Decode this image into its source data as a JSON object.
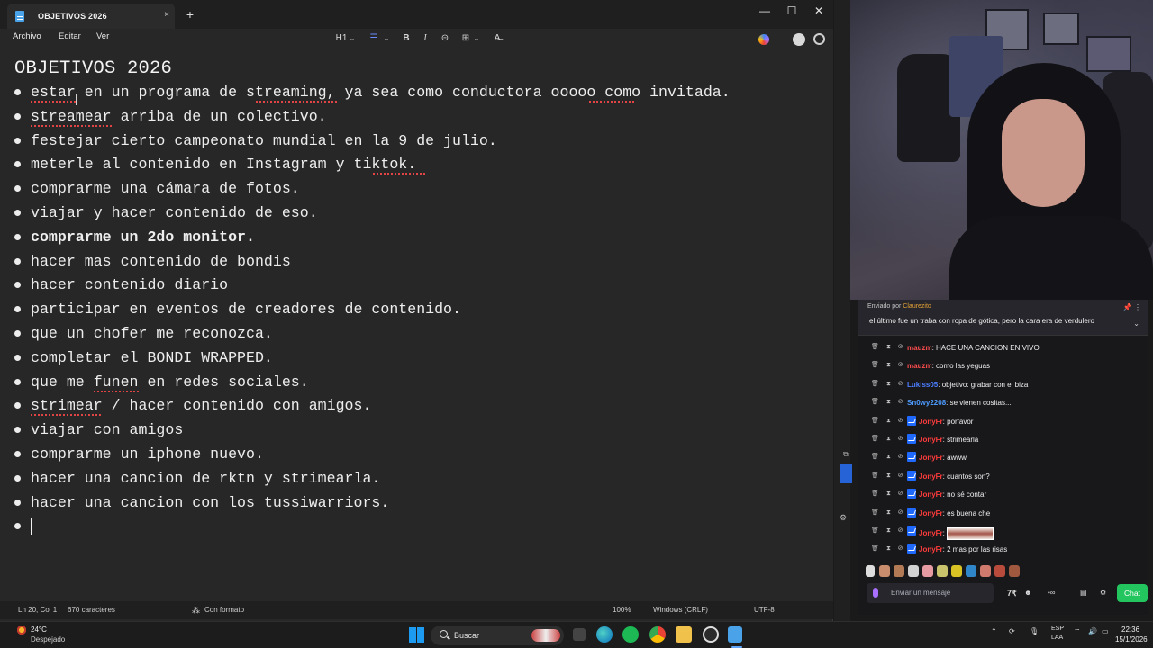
{
  "notepad": {
    "tab_title": "OBJETIVOS 2026",
    "tab_close": "×",
    "new_tab": "+",
    "window_controls": {
      "minimize": "—",
      "maximize": "☐",
      "close": "✕"
    },
    "menu": [
      "Archivo",
      "Editar",
      "Ver"
    ],
    "toolbar": {
      "heading": "H1",
      "list": "☰",
      "bold": "B",
      "italic": "I",
      "link": "⊝",
      "table": "⊞",
      "clear_format": "A̶",
      "chevron": "⌄"
    },
    "document": {
      "title": "OBJETIVOS 2026",
      "items": [
        "estar en un programa de streaming, ya sea como conductora ooooo como invitada.",
        "streamear arriba de un colectivo.",
        "festejar cierto campeonato mundial en la 9 de julio.",
        "meterle al contenido en Instagram y tiktok.",
        "comprarme una cámara de fotos.",
        "viajar y hacer contenido de eso.",
        "comprarme un 2do monitor.",
        "hacer mas contenido de bondis",
        "hacer contenido diario",
        "participar en eventos de creadores de contenido.",
        "que un chofer me reconozca.",
        "completar el BONDI WRAPPED.",
        "que me funen en redes sociales.",
        "strimear / hacer contenido con amigos.",
        "viajar con amigos",
        "comprarme un iphone nuevo.",
        "hacer una cancion de rktn y strimearla.",
        "hacer una cancion con los tussiwarriors.",
        ""
      ]
    },
    "status": {
      "position": "Ln 20, Col 1",
      "chars": "670 caracteres",
      "format": "Con formato",
      "zoom": "100%",
      "line_endings": "Windows (CRLF)",
      "encoding": "UTF-8"
    }
  },
  "chat": {
    "pinned": {
      "label": "Enviado por",
      "user": "Claurezito",
      "message": "el último fue un traba con ropa de gótica, pero la cara era de verdulero"
    },
    "messages": [
      {
        "user": "mauzm",
        "color": "#ff4d4d",
        "text": ": HACE UNA CANCION EN VIVO",
        "badge": false
      },
      {
        "user": "mauzm",
        "color": "#ff4d4d",
        "text": ": como las yeguas",
        "badge": false
      },
      {
        "user": "Lukiss05",
        "color": "#4c7dff",
        "text": ": objetivo: grabar con el biza",
        "badge": false
      },
      {
        "user": "Sn0wy2208",
        "color": "#4d9bff",
        "text": ": se vienen cositas...",
        "badge": false
      },
      {
        "user": "JonyFr",
        "color": "#ff3c3c",
        "text": ": porfavor",
        "badge": true
      },
      {
        "user": "JonyFr",
        "color": "#ff3c3c",
        "text": ": strimearla",
        "badge": true
      },
      {
        "user": "JonyFr",
        "color": "#ff3c3c",
        "text": ": awww",
        "badge": true
      },
      {
        "user": "JonyFr",
        "color": "#ff3c3c",
        "text": ": cuantos son?",
        "badge": true
      },
      {
        "user": "JonyFr",
        "color": "#ff3c3c",
        "text": ": no sé contar",
        "badge": true
      },
      {
        "user": "JonyFr",
        "color": "#ff3c3c",
        "text": ": es buena che",
        "badge": true
      },
      {
        "user": "JonyFr",
        "color": "#ff3c3c",
        "text": ":",
        "badge": true,
        "emote": true
      },
      {
        "user": "JonyFr",
        "color": "#ff3c3c",
        "text": ": 2 mas por las risas",
        "badge": true
      }
    ],
    "input_placeholder": "Enviar un mensaje",
    "send_label": "Chat"
  },
  "taskbar": {
    "weather_temp": "24°C",
    "weather_desc": "Despejado",
    "search_label": "Buscar",
    "lang_line1": "ESP",
    "lang_line2": "LAA",
    "time": "22:36",
    "date": "15/1/2026"
  }
}
